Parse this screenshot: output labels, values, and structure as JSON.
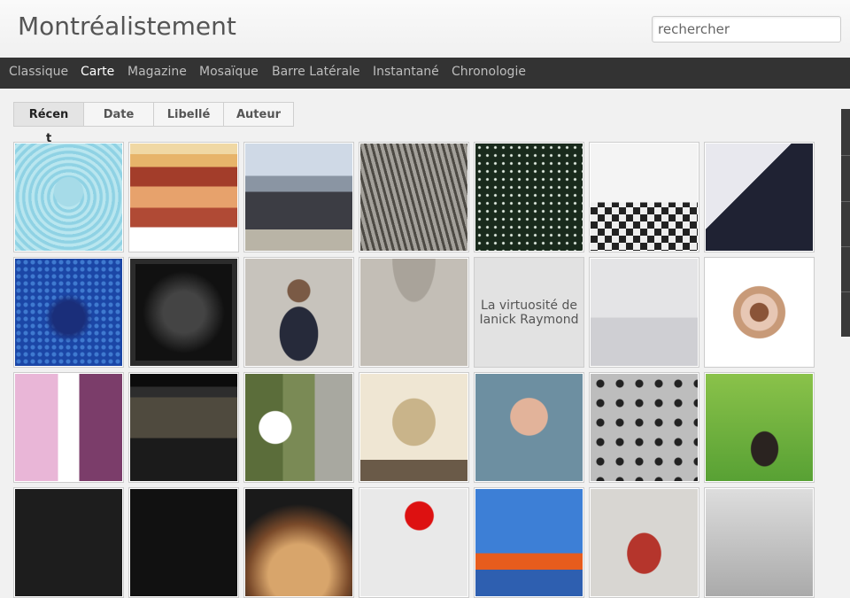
{
  "site": {
    "title": "Montréalistement"
  },
  "search": {
    "placeholder": "rechercher"
  },
  "nav": {
    "items": [
      {
        "label": "Classique",
        "active": false
      },
      {
        "label": "Carte",
        "active": true
      },
      {
        "label": "Magazine",
        "active": false
      },
      {
        "label": "Mosaïque",
        "active": false
      },
      {
        "label": "Barre Latérale",
        "active": false
      },
      {
        "label": "Instantané",
        "active": false
      },
      {
        "label": "Chronologie",
        "active": false
      }
    ]
  },
  "sort_tabs": {
    "items": [
      {
        "label": "Récen",
        "active": true
      },
      {
        "label": "Date",
        "active": false
      },
      {
        "label": "Libellé",
        "active": false
      },
      {
        "label": "Auteur",
        "active": false
      }
    ],
    "overflow_text": "t"
  },
  "tiles": {
    "text_tile": {
      "line1": "La virtuosité de",
      "line2": "Ianick Raymond"
    }
  },
  "colors": {
    "navbar": "#333333",
    "nav_active": "#ffffff",
    "nav_inactive": "#bdbdbd"
  }
}
